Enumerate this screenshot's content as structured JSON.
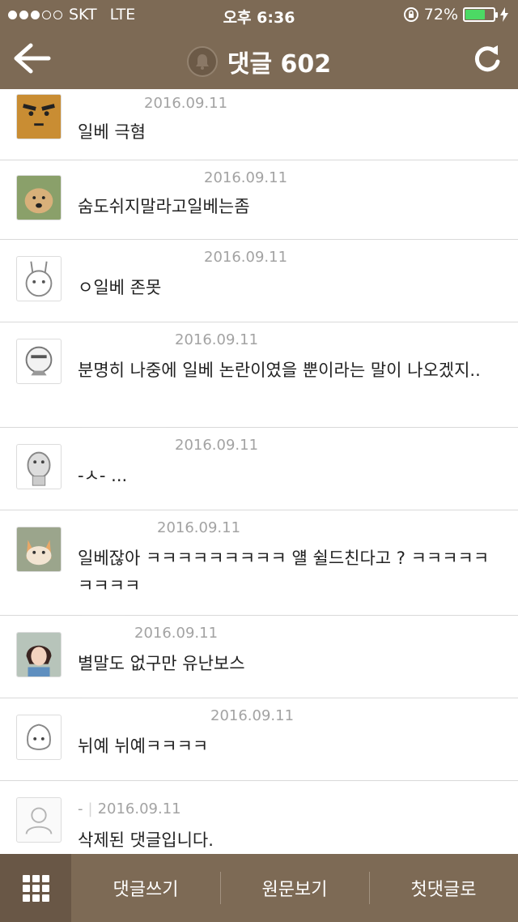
{
  "status_bar": {
    "carrier": "SKT",
    "network": "LTE",
    "time": "오후 6:36",
    "battery": "72%",
    "battery_level": 0.72
  },
  "header": {
    "title": "댓글 602",
    "back_icon": "arrow-left-icon",
    "bell_icon": "bell-icon",
    "refresh_icon": "refresh-icon"
  },
  "comments": [
    {
      "nickname": "",
      "date": "2016.09.11",
      "text": "일베 극혐",
      "avatar": "cartoon-face"
    },
    {
      "nickname": "",
      "date": "2016.09.11",
      "text": "숨도쉬지말라고일베는좀",
      "avatar": "dog-photo"
    },
    {
      "nickname": "",
      "date": "2016.09.11",
      "text": "ㅇ일베 존못",
      "avatar": "rabbit-character"
    },
    {
      "nickname": "",
      "date": "2016.09.11",
      "text": "분명히 나중에 일베 논란이였을 뿐이라는 말이 나오겠지..",
      "avatar": "cartoon-man"
    },
    {
      "nickname": "",
      "date": "2016.09.11",
      "text": "-ㅅ- ...",
      "avatar": "dog-character"
    },
    {
      "nickname": "",
      "date": "2016.09.11",
      "text": "일베잖아 ㅋㅋㅋㅋㅋㅋㅋㅋㅋ 얠 쉴드친다고 ? ㅋㅋㅋㅋㅋㅋㅋㅋㅋ",
      "avatar": "cat-photo"
    },
    {
      "nickname": "",
      "date": "2016.09.11",
      "text": "별말도 없구만 유난보스",
      "avatar": "woman-photo"
    },
    {
      "nickname": "",
      "date": "2016.09.11",
      "text": "뉘예 뉘예ㅋㅋㅋㅋ",
      "avatar": "peach-character"
    },
    {
      "nickname": "-",
      "date": "2016.09.11",
      "text": "삭제된 댓글입니다.",
      "avatar": "default-user"
    }
  ],
  "bottom_bar": {
    "menu_icon": "grid-icon",
    "write": "댓글쓰기",
    "original": "원문보기",
    "first": "첫댓글로"
  },
  "colors": {
    "bar": "#7d6a55",
    "bar_dark": "#695746",
    "meta_text": "#a3a3a3",
    "battery_green": "#4cd964"
  }
}
